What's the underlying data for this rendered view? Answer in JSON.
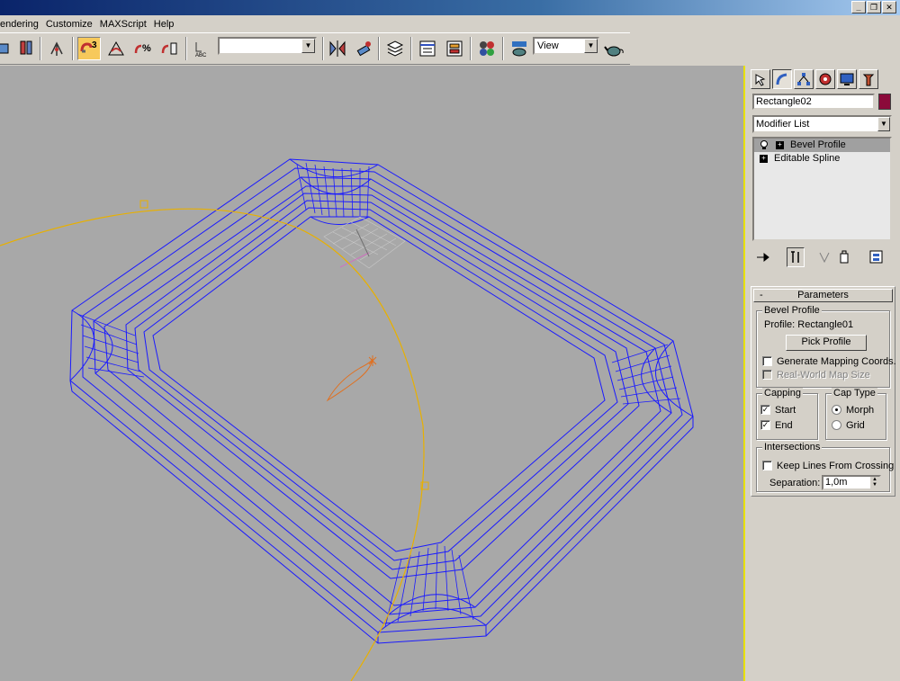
{
  "menubar": {
    "items": [
      "endering",
      "Customize",
      "MAXScript",
      "Help"
    ]
  },
  "window_controls": [
    "_",
    "❐",
    "✕"
  ],
  "toolbar": {
    "snap_value": "3",
    "named_selection_value": "",
    "reference_coord": "View"
  },
  "command_panel": {
    "object_name": "Rectangle02",
    "object_color": "#8b0a3a",
    "modifier_list_label": "Modifier List",
    "stack": [
      {
        "label": "Bevel Profile",
        "selected": true,
        "lightbulb": true
      },
      {
        "label": "Editable Spline",
        "selected": false,
        "lightbulb": false
      }
    ],
    "rollout": {
      "title": "Parameters",
      "bevel_profile_group": "Bevel Profile",
      "profile_text": "Profile: Rectangle01",
      "pick_profile_button": "Pick Profile",
      "generate_mapping": {
        "label": "Generate Mapping Coords.",
        "checked": false
      },
      "real_world_map": {
        "label": "Real-World Map Size",
        "checked": false,
        "enabled": false
      },
      "capping_group": "Capping",
      "cap_start": {
        "label": "Start",
        "checked": true
      },
      "cap_end": {
        "label": "End",
        "checked": true
      },
      "cap_type_group": "Cap Type",
      "cap_morph": {
        "label": "Morph",
        "selected": true
      },
      "cap_grid": {
        "label": "Grid",
        "selected": false
      },
      "intersections_group": "Intersections",
      "keep_lines": {
        "label": "Keep Lines From Crossing",
        "checked": false
      },
      "separation_label": "Separation:",
      "separation_value": "1,0m"
    }
  },
  "colors": {
    "wireframe": "#1a1aff",
    "helper_curve": "#e8b000",
    "viewport_bg": "#a8a8a8",
    "active_snap": "#f7c95b"
  }
}
